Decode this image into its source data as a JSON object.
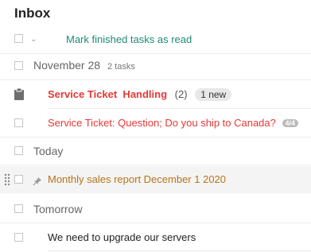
{
  "header": {
    "title": "Inbox"
  },
  "toolbar": {
    "mark_read_label": "Mark finished tasks as read"
  },
  "groups": [
    {
      "label": "November 28",
      "count": "2 tasks"
    },
    {
      "label": "Today"
    },
    {
      "label": "Tomorrow"
    }
  ],
  "tasks": [
    {
      "title": "Service Ticket  Handling",
      "count": "(2)",
      "badge": "1 new"
    },
    {
      "title": "Service Ticket: Question; Do you ship to Canada?",
      "badge": "4/4"
    },
    {
      "title": "Monthly sales report December 1 2020"
    },
    {
      "title": "We need to upgrade our servers"
    }
  ],
  "colors": {
    "accent_teal": "#1e8a78",
    "ticket_red": "#e53935",
    "report_orange": "#b8741a"
  },
  "icons": [
    "clipboard-icon",
    "drag-handle-icon",
    "pin-icon",
    "chevron-down-icon"
  ]
}
